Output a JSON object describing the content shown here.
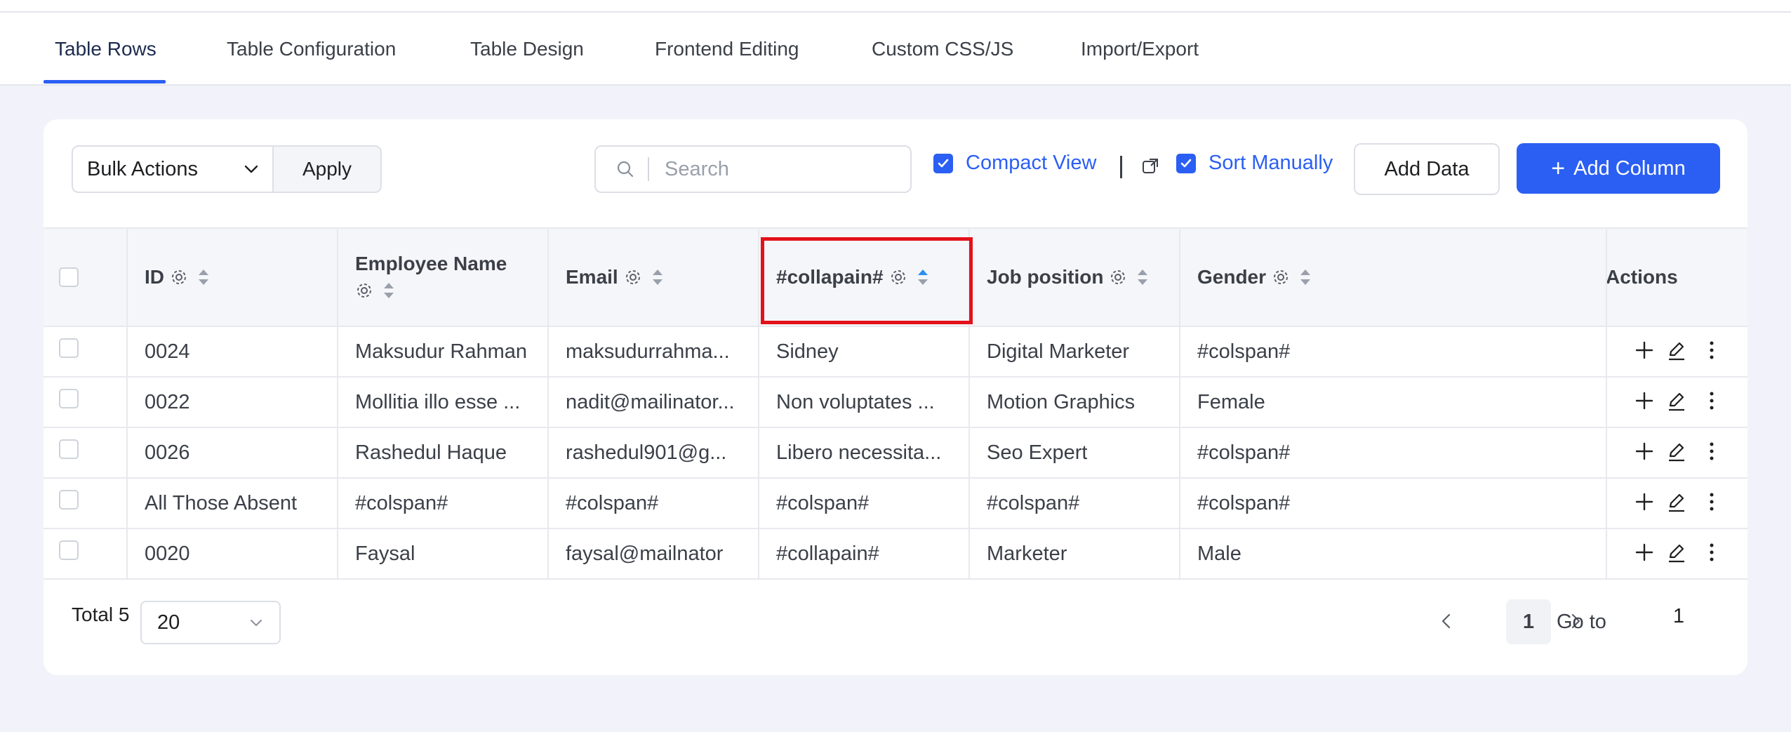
{
  "tabs": [
    {
      "label": "Table Rows",
      "active": true
    },
    {
      "label": "Table Configuration",
      "active": false
    },
    {
      "label": "Table Design",
      "active": false
    },
    {
      "label": "Frontend Editing",
      "active": false
    },
    {
      "label": "Custom CSS/JS",
      "active": false
    },
    {
      "label": "Import/Export",
      "active": false
    }
  ],
  "toolbar": {
    "bulk_actions": "Bulk Actions",
    "apply": "Apply",
    "search_placeholder": "Search",
    "compact_view": "Compact View",
    "sort_manually": "Sort Manually",
    "add_data": "Add Data",
    "add_column": "Add Column"
  },
  "table": {
    "headers": {
      "id": "ID",
      "name": "Employee Name",
      "email": "Email",
      "collapain": "#collapain#",
      "job": "Job position",
      "gender": "Gender",
      "actions": "Actions"
    },
    "rows": [
      {
        "id": "0024",
        "name": "Maksudur Rahman",
        "email": "maksudurrahma...",
        "collapain": "Sidney",
        "job": "Digital Marketer",
        "gender": "#colspan#"
      },
      {
        "id": "0022",
        "name": "Mollitia illo esse ...",
        "email": "nadit@mailinator...",
        "collapain": "Non voluptates ...",
        "job": "Motion Graphics",
        "gender": "Female"
      },
      {
        "id": "0026",
        "name": "Rashedul Haque",
        "email": "rashedul901@g...",
        "collapain": "Libero necessita...",
        "job": "Seo Expert",
        "gender": "#colspan#"
      },
      {
        "id": "All Those Absent",
        "name": "#colspan#",
        "email": "#colspan#",
        "collapain": "#colspan#",
        "job": "#colspan#",
        "gender": "#colspan#"
      },
      {
        "id": "0020",
        "name": "Faysal",
        "email": "faysal@mailnator",
        "collapain": "#collapain#",
        "job": "Marketer",
        "gender": "Male"
      }
    ]
  },
  "footer": {
    "total": "Total 5",
    "page_size": "20",
    "current_page": "1",
    "goto_label": "Go to",
    "goto_value": "1"
  },
  "colors": {
    "accent": "#2b5ff3",
    "highlight": "#e3121a"
  }
}
